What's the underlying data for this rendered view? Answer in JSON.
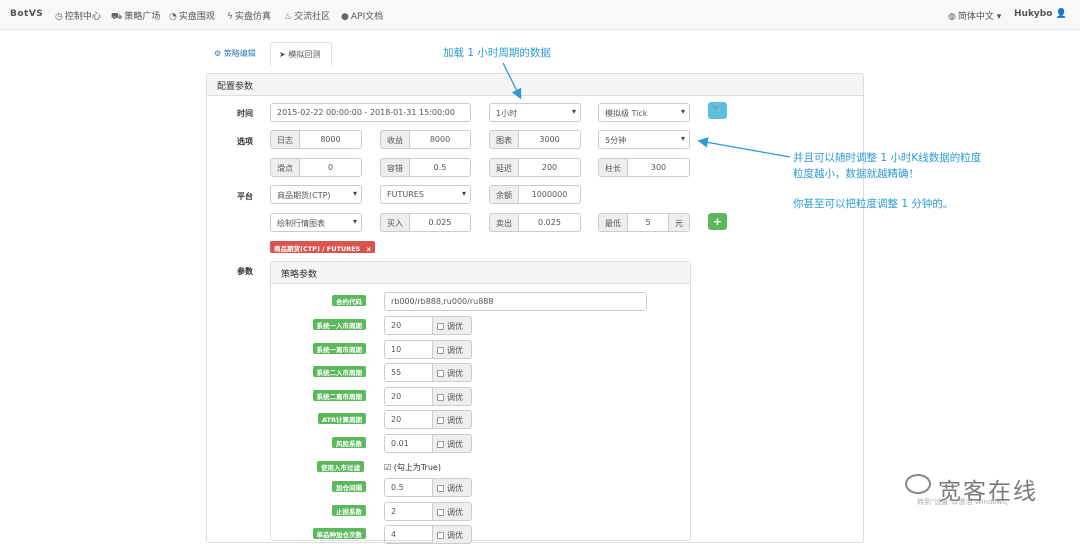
{
  "nav": {
    "brand": "BotVS",
    "items": [
      {
        "icon": "dashboard-icon",
        "glyph": "◷",
        "label": "控制中心"
      },
      {
        "icon": "cart-icon",
        "glyph": "⛟",
        "label": "策略广场"
      },
      {
        "icon": "clock-icon",
        "glyph": "◔",
        "label": "实盘围观"
      },
      {
        "icon": "bolt-icon",
        "glyph": "ϟ",
        "label": "实盘仿真"
      },
      {
        "icon": "fire-icon",
        "glyph": "♨",
        "label": "交流社区"
      },
      {
        "icon": "api-icon",
        "glyph": "●",
        "label": "API文档"
      }
    ],
    "language": "简体中文",
    "user": "Hukybo"
  },
  "tabs": [
    {
      "label": "策略编辑",
      "icon": "cogs-icon"
    },
    {
      "label": "模拟回测",
      "icon": "send-icon",
      "active": true
    }
  ],
  "config": {
    "title": "配置参数",
    "labels": {
      "time": "时间",
      "options": "选项",
      "platform": "平台",
      "params": "参数"
    },
    "time_range": "2015-02-22 00:00:00 - 2018-01-31 15:00:00",
    "period": "1小时",
    "tick_mode": "模拟级 Tick",
    "granularity": "5分钟",
    "log": {
      "label": "日志",
      "value": "8000"
    },
    "profit": {
      "label": "收益",
      "value": "8000"
    },
    "chart": {
      "label": "图表",
      "value": "3000"
    },
    "slippage": {
      "label": "滑点",
      "value": "0"
    },
    "fault": {
      "label": "容错",
      "value": "0.5"
    },
    "delay": {
      "label": "延迟",
      "value": "200"
    },
    "bar_len": {
      "label": "柱长",
      "value": "300"
    },
    "exchange": "商品期货(CTP)",
    "contract_type": "FUTURES",
    "balance": {
      "label": "余额",
      "value": "1000000"
    },
    "chart_type": "绘制行情图表",
    "buy": {
      "label": "买入",
      "value": "0.025"
    },
    "sell": {
      "label": "卖出",
      "value": "0.025"
    },
    "min": {
      "label": "最低",
      "value": "5",
      "unit": "元"
    },
    "tag": "商品期货(CTP) / FUTURES",
    "tag_close": "x"
  },
  "strategy": {
    "title": "策略参数",
    "contract_label": "合约代码",
    "contract_value": "rb000/rb888,ru000/ru888",
    "optimize_label": "调优",
    "params": [
      {
        "label": "系统一入市周期",
        "value": "20"
      },
      {
        "label": "系统一离市周期",
        "value": "10"
      },
      {
        "label": "系统二入市周期",
        "value": "55"
      },
      {
        "label": "系统二离市周期",
        "value": "20"
      },
      {
        "label": "ATR计算周期",
        "value": "20"
      },
      {
        "label": "风险系数",
        "value": "0.01"
      }
    ],
    "filter_label": "使用入市过滤",
    "filter_text": "(勾上为True)",
    "params2": [
      {
        "label": "加仓间隔",
        "value": "0.5"
      },
      {
        "label": "止损系数",
        "value": "2"
      },
      {
        "label": "单品种加仓次数",
        "value": "4"
      }
    ]
  },
  "annotations": {
    "top": "加载 1 小时周期的数据",
    "right_1": "并且可以随时调整 1 小时K线数据的粒度",
    "right_2": "粒度越小，数据就越精确！",
    "right_3": "你甚至可以把粒度调整 1 分钟的。"
  },
  "watermark": {
    "brand": "宽客在线",
    "sub": "转到\"设置\"以激活 Windows。"
  },
  "colors": {
    "accent": "#2e9bd6",
    "green": "#5cb85c",
    "red": "#d9534f",
    "info": "#5bc0de"
  }
}
